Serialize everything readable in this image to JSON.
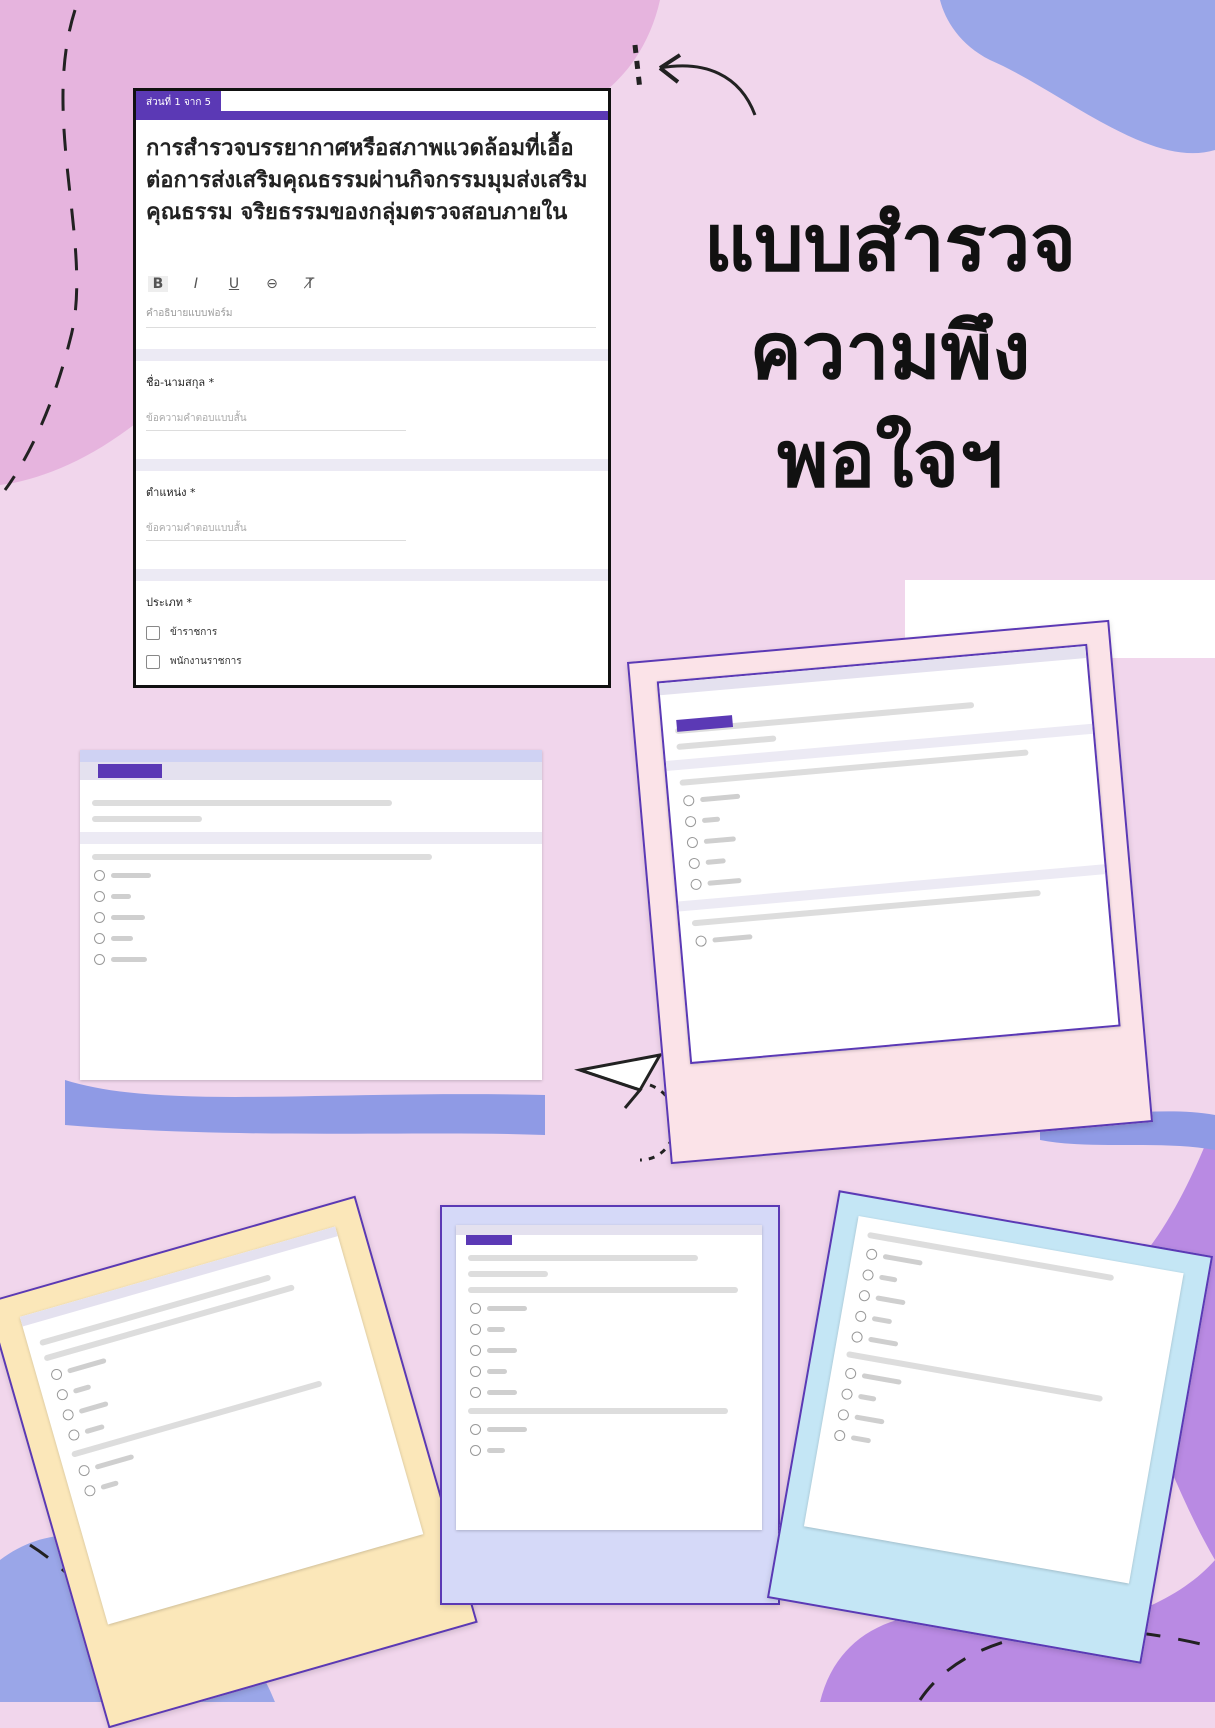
{
  "poster": {
    "heading_lines": [
      "แบบสำรวจ",
      "ความพึง",
      "พอใจฯ"
    ]
  },
  "main_form": {
    "section_label": "ส่วนที่ 1 จาก 5",
    "title": "การสำรวจบรรยากาศหรือสภาพแวดล้อมที่เอื้อต่อการส่งเสริมคุณธรรมผ่านกิจกรรมมุมส่งเสริมคุณธรรม จริยธรรมของกลุ่มตรวจสอบภายใน",
    "toolbar": [
      "B",
      "I",
      "U",
      "⊖",
      "T̸"
    ],
    "description_placeholder": "คำอธิบายแบบฟอร์ม",
    "questions": [
      {
        "label": "ชื่อ-นามสกุล *",
        "placeholder": "ข้อความคำตอบแบบสั้น"
      },
      {
        "label": "ตำแหน่ง *",
        "placeholder": "ข้อความคำตอบแบบสั้น"
      }
    ],
    "checkbox_question": {
      "label": "ประเภท *",
      "options": [
        "ข้าราชการ",
        "พนักงานราชการ"
      ]
    }
  },
  "colors": {
    "background": "#f1d6ec",
    "form_accent": "#5b39b5",
    "blob_blue": "#9aa6e8",
    "blob_purple": "#b98ae3"
  }
}
